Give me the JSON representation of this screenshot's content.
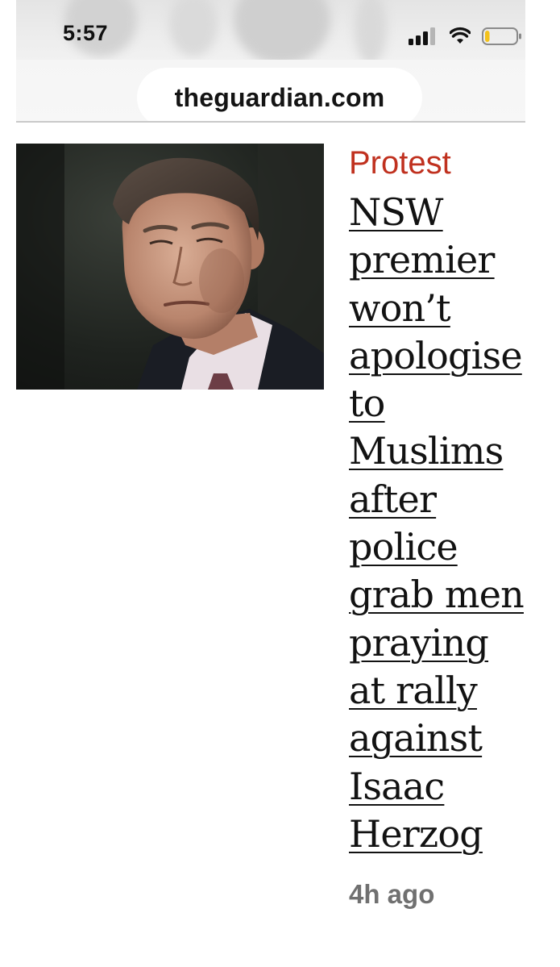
{
  "status_bar": {
    "time": "5:57",
    "icons": [
      "cellular-signal-icon",
      "wifi-icon",
      "battery-icon"
    ],
    "battery_level": 0.15
  },
  "browser": {
    "url": "theguardian.com"
  },
  "article": {
    "kicker": "Protest",
    "kicker_color": "#c0311f",
    "headline_lines": [
      "NSW",
      "premier",
      "won’t",
      "apologise",
      "to",
      "Muslims",
      "after",
      "police",
      "grab men",
      "praying",
      "at rally",
      "against",
      "Isaac",
      "Herzog"
    ],
    "timestamp": "4h ago",
    "image": "portrait-photo"
  }
}
